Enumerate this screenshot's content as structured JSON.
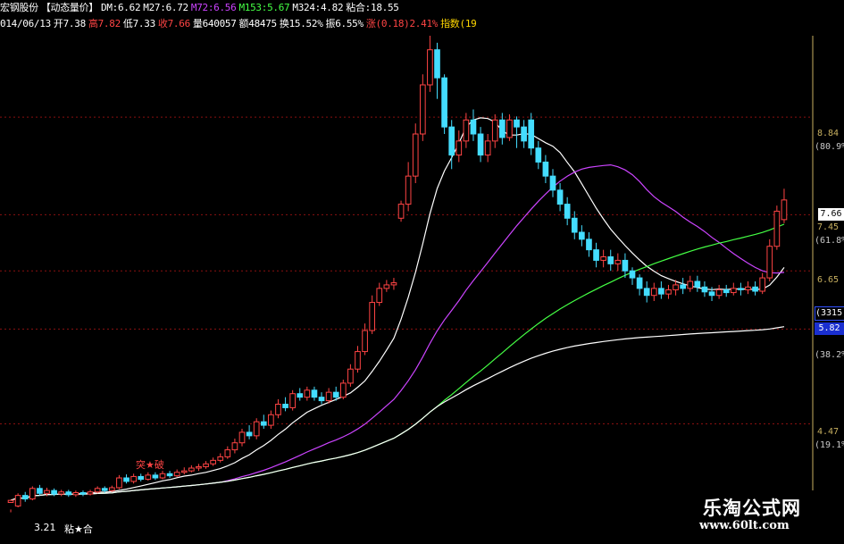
{
  "header": {
    "row1": [
      {
        "text": "宏钢股份",
        "color": "#ffffff"
      },
      {
        "text": "【动态量价】",
        "color": "#ffffff"
      },
      {
        "text": "DM:6.62",
        "color": "#ffffff"
      },
      {
        "text": "M27:6.72",
        "color": "#ffffff"
      },
      {
        "text": "M72:6.56",
        "color": "#cc44ff"
      },
      {
        "text": "M153:5.67",
        "color": "#44ff44"
      },
      {
        "text": "M324:4.82",
        "color": "#ffffff"
      },
      {
        "text": "粘合:18.55",
        "color": "#ffffff"
      }
    ],
    "row2": [
      {
        "text": "014/06/13",
        "color": "#ffffff"
      },
      {
        "text": "开7.38",
        "color": "#ffffff"
      },
      {
        "text": "高7.82",
        "color": "#ff4444"
      },
      {
        "text": "低7.33",
        "color": "#ffffff"
      },
      {
        "text": "收7.66",
        "color": "#ff4444"
      },
      {
        "text": "量640057",
        "color": "#ffffff"
      },
      {
        "text": "额48475",
        "color": "#ffffff"
      },
      {
        "text": "换15.52%",
        "color": "#ffffff"
      },
      {
        "text": "振6.55%",
        "color": "#ffffff"
      },
      {
        "text": "涨(0.18)2.41%",
        "color": "#ff4444"
      },
      {
        "text": "指数(19.0",
        "color": "#ffd700"
      }
    ]
  },
  "right_axis": {
    "ticks": [
      {
        "label": "8.84",
        "pct": "(80.9%)"
      },
      {
        "label": "7.45",
        "pct": "(61.8%)"
      },
      {
        "label": "6.65",
        "pct": ""
      },
      {
        "label": "5.82",
        "pct": "(38.2%)"
      },
      {
        "label": "4.47",
        "pct": "(19.1%)"
      }
    ],
    "current_price": "7.66",
    "index_box": "(3315)"
  },
  "annotations": {
    "breakout_label": "突★破",
    "low_price": "3.21",
    "glue_label": "粘★合"
  },
  "watermark": {
    "title": "乐淘公式网",
    "url": "www.60lt.com"
  },
  "chart_data": {
    "type": "candlestick",
    "title": "",
    "ylim": [
      3.0,
      10.0
    ],
    "up_color": "#ff4444",
    "down_color": "#44ddff",
    "ma_colors": {
      "M27": "#ffffff",
      "M72": "#cc44ff",
      "M153": "#44ff44",
      "M324": "#ffffff"
    },
    "candles": [
      [
        3.35,
        3.38,
        3.25,
        3.21
      ],
      [
        3.3,
        3.45,
        3.48,
        3.28
      ],
      [
        3.45,
        3.4,
        3.5,
        3.36
      ],
      [
        3.4,
        3.55,
        3.58,
        3.38
      ],
      [
        3.55,
        3.48,
        3.6,
        3.45
      ],
      [
        3.48,
        3.52,
        3.56,
        3.44
      ],
      [
        3.52,
        3.47,
        3.55,
        3.44
      ],
      [
        3.47,
        3.5,
        3.53,
        3.44
      ],
      [
        3.5,
        3.46,
        3.53,
        3.43
      ],
      [
        3.46,
        3.49,
        3.52,
        3.43
      ],
      [
        3.49,
        3.47,
        3.52,
        3.44
      ],
      [
        3.47,
        3.5,
        3.53,
        3.45
      ],
      [
        3.5,
        3.55,
        3.58,
        3.48
      ],
      [
        3.55,
        3.52,
        3.58,
        3.49
      ],
      [
        3.52,
        3.56,
        3.59,
        3.5
      ],
      [
        3.56,
        3.7,
        3.74,
        3.54
      ],
      [
        3.7,
        3.65,
        3.75,
        3.62
      ],
      [
        3.65,
        3.72,
        3.76,
        3.62
      ],
      [
        3.72,
        3.68,
        3.76,
        3.65
      ],
      [
        3.68,
        3.74,
        3.78,
        3.66
      ],
      [
        3.74,
        3.7,
        3.78,
        3.67
      ],
      [
        3.7,
        3.76,
        3.8,
        3.68
      ],
      [
        3.76,
        3.73,
        3.8,
        3.7
      ],
      [
        3.73,
        3.78,
        3.82,
        3.71
      ],
      [
        3.78,
        3.8,
        3.85,
        3.75
      ],
      [
        3.8,
        3.84,
        3.88,
        3.78
      ],
      [
        3.84,
        3.86,
        3.9,
        3.8
      ],
      [
        3.86,
        3.9,
        3.94,
        3.83
      ],
      [
        3.9,
        3.95,
        3.99,
        3.87
      ],
      [
        3.95,
        4.0,
        4.05,
        3.92
      ],
      [
        4.0,
        4.1,
        4.15,
        3.97
      ],
      [
        4.1,
        4.2,
        4.26,
        4.05
      ],
      [
        4.2,
        4.35,
        4.4,
        4.15
      ],
      [
        4.35,
        4.3,
        4.45,
        4.25
      ],
      [
        4.3,
        4.5,
        4.55,
        4.25
      ],
      [
        4.5,
        4.45,
        4.6,
        4.4
      ],
      [
        4.45,
        4.6,
        4.66,
        4.4
      ],
      [
        4.6,
        4.75,
        4.82,
        4.55
      ],
      [
        4.75,
        4.7,
        4.85,
        4.65
      ],
      [
        4.7,
        4.9,
        4.95,
        4.66
      ],
      [
        4.9,
        4.85,
        4.98,
        4.8
      ],
      [
        4.85,
        4.95,
        5.0,
        4.8
      ],
      [
        4.95,
        4.85,
        5.0,
        4.8
      ],
      [
        4.85,
        4.8,
        4.92,
        4.75
      ],
      [
        4.8,
        4.92,
        4.98,
        4.76
      ],
      [
        4.92,
        4.85,
        5.0,
        4.8
      ],
      [
        4.85,
        5.05,
        5.1,
        4.82
      ],
      [
        5.05,
        5.25,
        5.32,
        5.0
      ],
      [
        5.25,
        5.5,
        5.58,
        5.2
      ],
      [
        5.5,
        5.8,
        5.9,
        5.45
      ],
      [
        5.8,
        6.2,
        6.3,
        5.75
      ],
      [
        6.2,
        6.4,
        6.48,
        6.15
      ],
      [
        6.4,
        6.45,
        6.52,
        6.35
      ],
      [
        6.45,
        6.48,
        6.55,
        6.38
      ],
      [
        7.4,
        7.6,
        7.65,
        7.35
      ],
      [
        7.6,
        8.0,
        8.2,
        7.5
      ],
      [
        8.0,
        8.6,
        8.75,
        7.9
      ],
      [
        8.6,
        9.3,
        9.45,
        8.5
      ],
      [
        9.3,
        9.8,
        10.0,
        9.2
      ],
      [
        9.8,
        9.4,
        9.9,
        9.1
      ],
      [
        9.4,
        8.7,
        9.45,
        8.6
      ],
      [
        8.7,
        8.3,
        8.8,
        8.1
      ],
      [
        8.3,
        8.5,
        8.65,
        8.2
      ],
      [
        8.5,
        8.8,
        8.9,
        8.4
      ],
      [
        8.8,
        8.6,
        8.95,
        8.5
      ],
      [
        8.6,
        8.3,
        8.7,
        8.2
      ],
      [
        8.3,
        8.5,
        8.6,
        8.2
      ],
      [
        8.5,
        8.8,
        8.88,
        8.4
      ],
      [
        8.8,
        8.55,
        8.9,
        8.45
      ],
      [
        8.55,
        8.8,
        8.88,
        8.5
      ],
      [
        8.8,
        8.7,
        8.85,
        8.4
      ],
      [
        8.7,
        8.5,
        8.8,
        8.4
      ],
      [
        8.8,
        8.4,
        8.9,
        8.3
      ],
      [
        8.4,
        8.2,
        8.5,
        8.1
      ],
      [
        8.2,
        8.0,
        8.3,
        7.9
      ],
      [
        8.0,
        7.8,
        8.1,
        7.7
      ],
      [
        7.8,
        7.6,
        7.9,
        7.5
      ],
      [
        7.6,
        7.4,
        7.7,
        7.3
      ],
      [
        7.4,
        7.2,
        7.5,
        7.1
      ],
      [
        7.2,
        7.1,
        7.3,
        7.0
      ],
      [
        7.1,
        6.95,
        7.2,
        6.85
      ],
      [
        6.95,
        6.8,
        7.05,
        6.7
      ],
      [
        6.8,
        6.85,
        6.95,
        6.7
      ],
      [
        6.85,
        6.75,
        6.95,
        6.65
      ],
      [
        6.75,
        6.8,
        6.9,
        6.65
      ],
      [
        6.8,
        6.65,
        6.9,
        6.55
      ],
      [
        6.65,
        6.55,
        6.7,
        6.45
      ],
      [
        6.55,
        6.4,
        6.6,
        6.3
      ],
      [
        6.4,
        6.3,
        6.5,
        6.2
      ],
      [
        6.3,
        6.4,
        6.48,
        6.22
      ],
      [
        6.4,
        6.32,
        6.5,
        6.25
      ],
      [
        6.32,
        6.38,
        6.45,
        6.25
      ],
      [
        6.38,
        6.45,
        6.52,
        6.3
      ],
      [
        6.45,
        6.4,
        6.55,
        6.32
      ],
      [
        6.4,
        6.5,
        6.58,
        6.35
      ],
      [
        6.5,
        6.42,
        6.58,
        6.35
      ],
      [
        6.42,
        6.35,
        6.5,
        6.28
      ],
      [
        6.35,
        6.3,
        6.42,
        6.22
      ],
      [
        6.3,
        6.38,
        6.45,
        6.25
      ],
      [
        6.38,
        6.34,
        6.45,
        6.28
      ],
      [
        6.34,
        6.4,
        6.48,
        6.3
      ],
      [
        6.4,
        6.38,
        6.48,
        6.3
      ],
      [
        6.38,
        6.42,
        6.5,
        6.32
      ],
      [
        6.42,
        6.36,
        6.5,
        6.3
      ],
      [
        6.36,
        6.55,
        6.62,
        6.32
      ],
      [
        6.55,
        7.0,
        7.1,
        6.5
      ],
      [
        7.0,
        7.5,
        7.58,
        6.95
      ],
      [
        7.38,
        7.66,
        7.82,
        7.33
      ]
    ]
  }
}
